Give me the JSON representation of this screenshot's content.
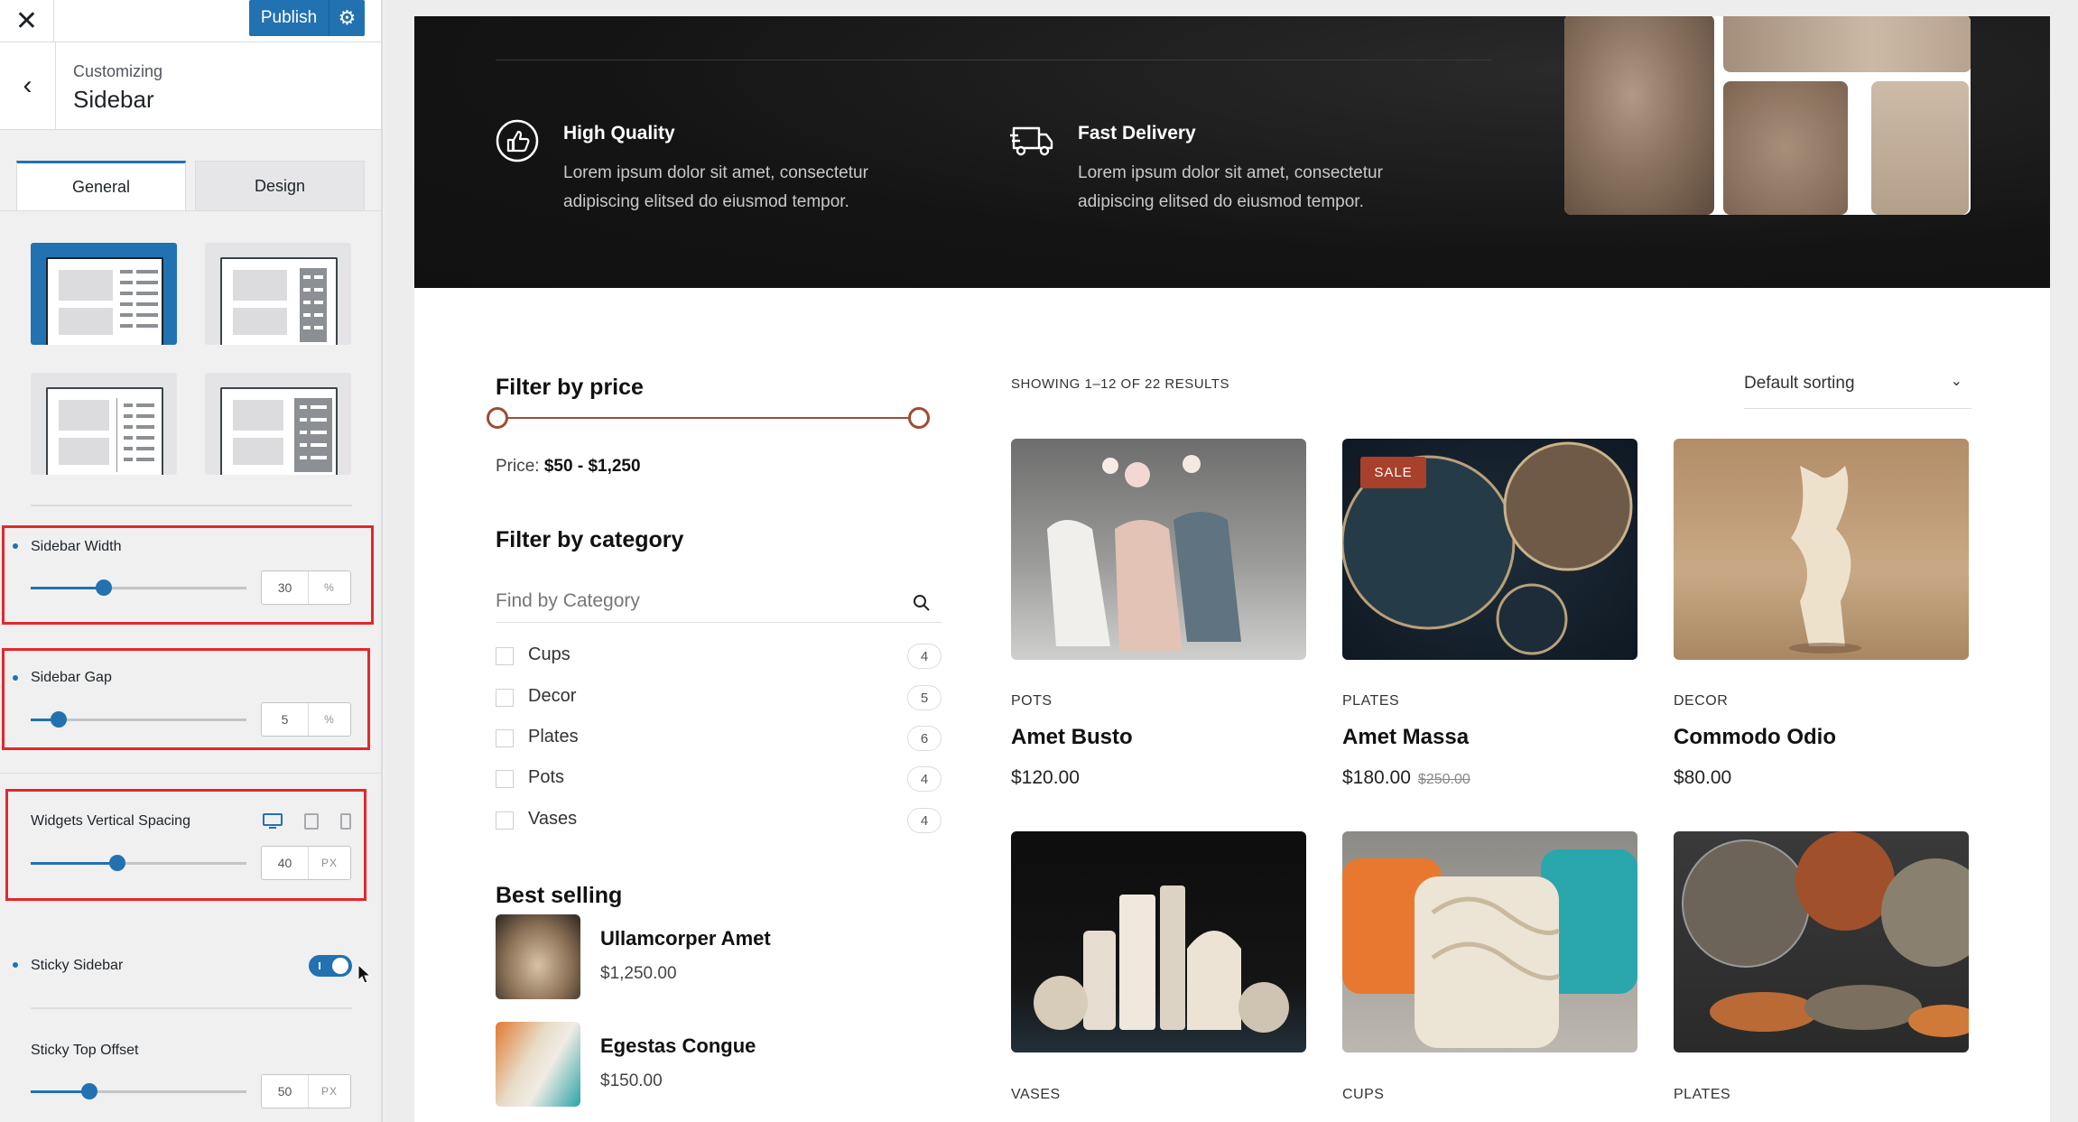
{
  "panel": {
    "close_icon": "close-icon",
    "publish_label": "Publish",
    "breadcrumb": "Customizing",
    "section_title": "Sidebar",
    "tabs": [
      "General",
      "Design"
    ],
    "layouts": [
      "left-sidebar",
      "right-sidebar",
      "left-sidebar-boxed",
      "right-sidebar-boxed"
    ],
    "controls": {
      "sidebar_width": {
        "label": "Sidebar Width",
        "value": "30",
        "unit": "%",
        "fraction": 0.34
      },
      "sidebar_gap": {
        "label": "Sidebar Gap",
        "value": "5",
        "unit": "%",
        "fraction": 0.13
      },
      "widgets_spacing": {
        "label": "Widgets Vertical Spacing",
        "value": "40",
        "unit": "PX",
        "fraction": 0.4
      },
      "sticky_sidebar": {
        "label": "Sticky Sidebar",
        "enabled": true
      },
      "sticky_offset": {
        "label": "Sticky Top Offset",
        "value": "50",
        "unit": "PX",
        "fraction": 0.27
      }
    },
    "accent": "#2271b1",
    "highlight": "#e3282a"
  },
  "site": {
    "features": [
      {
        "title": "High Quality",
        "text": "Lorem ipsum dolor sit amet, consectetur adipiscing elitsed do eiusmod tempor.",
        "icon": "thumbs-up-icon"
      },
      {
        "title": "Fast Delivery",
        "text": "Lorem ipsum dolor sit amet, consectetur adipiscing elitsed do eiusmod tempor.",
        "icon": "delivery-truck-icon"
      }
    ],
    "filter_price": {
      "title": "Filter by price",
      "label": "Price:",
      "range": "$50 - $1,250"
    },
    "filter_category": {
      "title": "Filter by category",
      "placeholder": "Find by Category",
      "items": [
        {
          "name": "Cups",
          "count": "4"
        },
        {
          "name": "Decor",
          "count": "5"
        },
        {
          "name": "Plates",
          "count": "6"
        },
        {
          "name": "Pots",
          "count": "4"
        },
        {
          "name": "Vases",
          "count": "4"
        }
      ]
    },
    "best_selling": {
      "title": "Best selling",
      "items": [
        {
          "name": "Ullamcorper Amet",
          "price": "$1,250.00"
        },
        {
          "name": "Egestas Congue",
          "price": "$150.00"
        }
      ]
    },
    "results": "SHOWING 1–12 OF 22 RESULTS",
    "sorting": "Default sorting",
    "products": [
      {
        "category": "POTS",
        "name": "Amet Busto",
        "price": "$120.00",
        "old_price": "",
        "sale": ""
      },
      {
        "category": "PLATES",
        "name": "Amet Massa",
        "price": "$180.00",
        "old_price": "$250.00",
        "sale": "SALE"
      },
      {
        "category": "DECOR",
        "name": "Commodo Odio",
        "price": "$80.00",
        "old_price": "",
        "sale": ""
      },
      {
        "category": "VASES"
      },
      {
        "category": "CUPS"
      },
      {
        "category": "PLATES"
      }
    ],
    "accent": "#a04a34"
  }
}
